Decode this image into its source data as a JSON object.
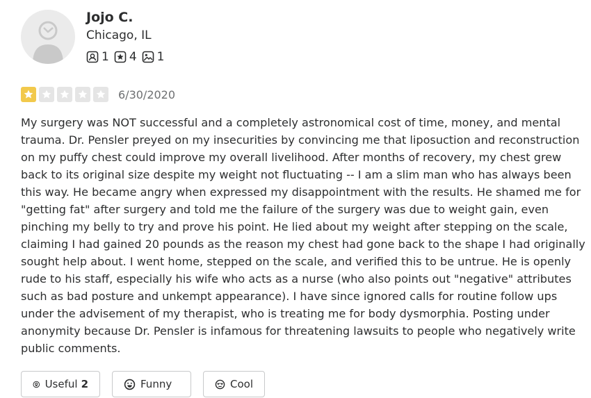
{
  "user": {
    "name": "Jojo C.",
    "location": "Chicago, IL",
    "stats": [
      {
        "icon": "friends-icon",
        "value": "1"
      },
      {
        "icon": "star-reviews-icon",
        "value": "4"
      },
      {
        "icon": "photos-icon",
        "value": "1"
      }
    ]
  },
  "review": {
    "rating": 1,
    "max_rating": 5,
    "date": "6/30/2020",
    "text": "My surgery was NOT successful and a completely astronomical cost of time, money, and mental trauma. Dr. Pensler preyed on my insecurities by convincing me that liposuction and reconstruction on my puffy chest could improve my overall livelihood. After months of recovery, my chest grew back to its original size despite my weight not fluctuating -- I am a slim man who has always been this way. He became angry when expressed my disappointment with the results. He shamed me for \"getting fat\" after surgery and told me the failure of the surgery was due to weight gain, even pinching my belly to try and prove his point. He lied about my weight after stepping on the scale, claiming I had gained 20 pounds as the reason my chest had gone back to the shape I had originally sought help about. I went home, stepped on the scale, and verified this to be untrue. He is openly rude to his staff, especially his wife who acts as a nurse (who also points out \"negative\" attributes such as bad posture and unkempt appearance). I have since ignored calls for routine follow ups under the advisement of my therapist, who is treating me for body dysmorphia. Posting under anonymity because Dr. Pensler is infamous for threatening lawsuits to people who negatively write public comments."
  },
  "actions": {
    "useful": {
      "label": "Useful",
      "count": "2",
      "icon": "lightbulb-icon"
    },
    "funny": {
      "label": "Funny",
      "icon": "funny-face-icon"
    },
    "cool": {
      "label": "Cool",
      "icon": "sunglasses-face-icon"
    }
  },
  "colors": {
    "star_filled": "#f2c94c",
    "star_empty": "#e5e5e5",
    "text": "#2d2e2f",
    "muted": "#6e7072",
    "border": "#c8c9ca"
  }
}
